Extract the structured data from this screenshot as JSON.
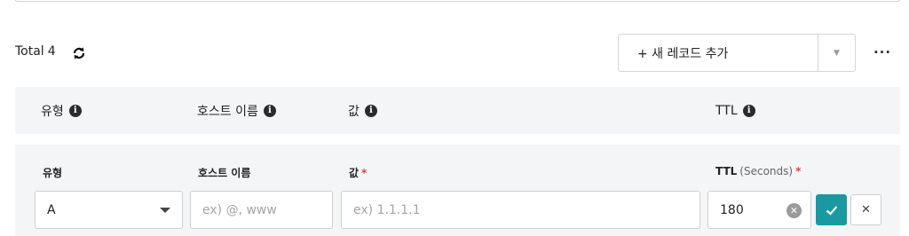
{
  "toolbar": {
    "total_label": "Total",
    "total_count": "4",
    "add_record_label": "+ 새 레코드 추가",
    "more_label": "···"
  },
  "table_header": {
    "type": "유형",
    "host": "호스트 이름",
    "value": "값",
    "ttl": "TTL"
  },
  "form": {
    "type_label": "유형",
    "host_label": "호스트 이름",
    "value_label": "값",
    "value_required": "*",
    "ttl_label": "TTL",
    "ttl_unit": "(Seconds)",
    "ttl_required": "*",
    "type_value": "A",
    "host_placeholder": "ex) @, www",
    "value_placeholder": "ex) 1.1.1.1",
    "ttl_value": "180"
  },
  "colors": {
    "accent": "#1a9aa0",
    "header_bg": "#f4f5f7",
    "required": "#e0463c"
  }
}
